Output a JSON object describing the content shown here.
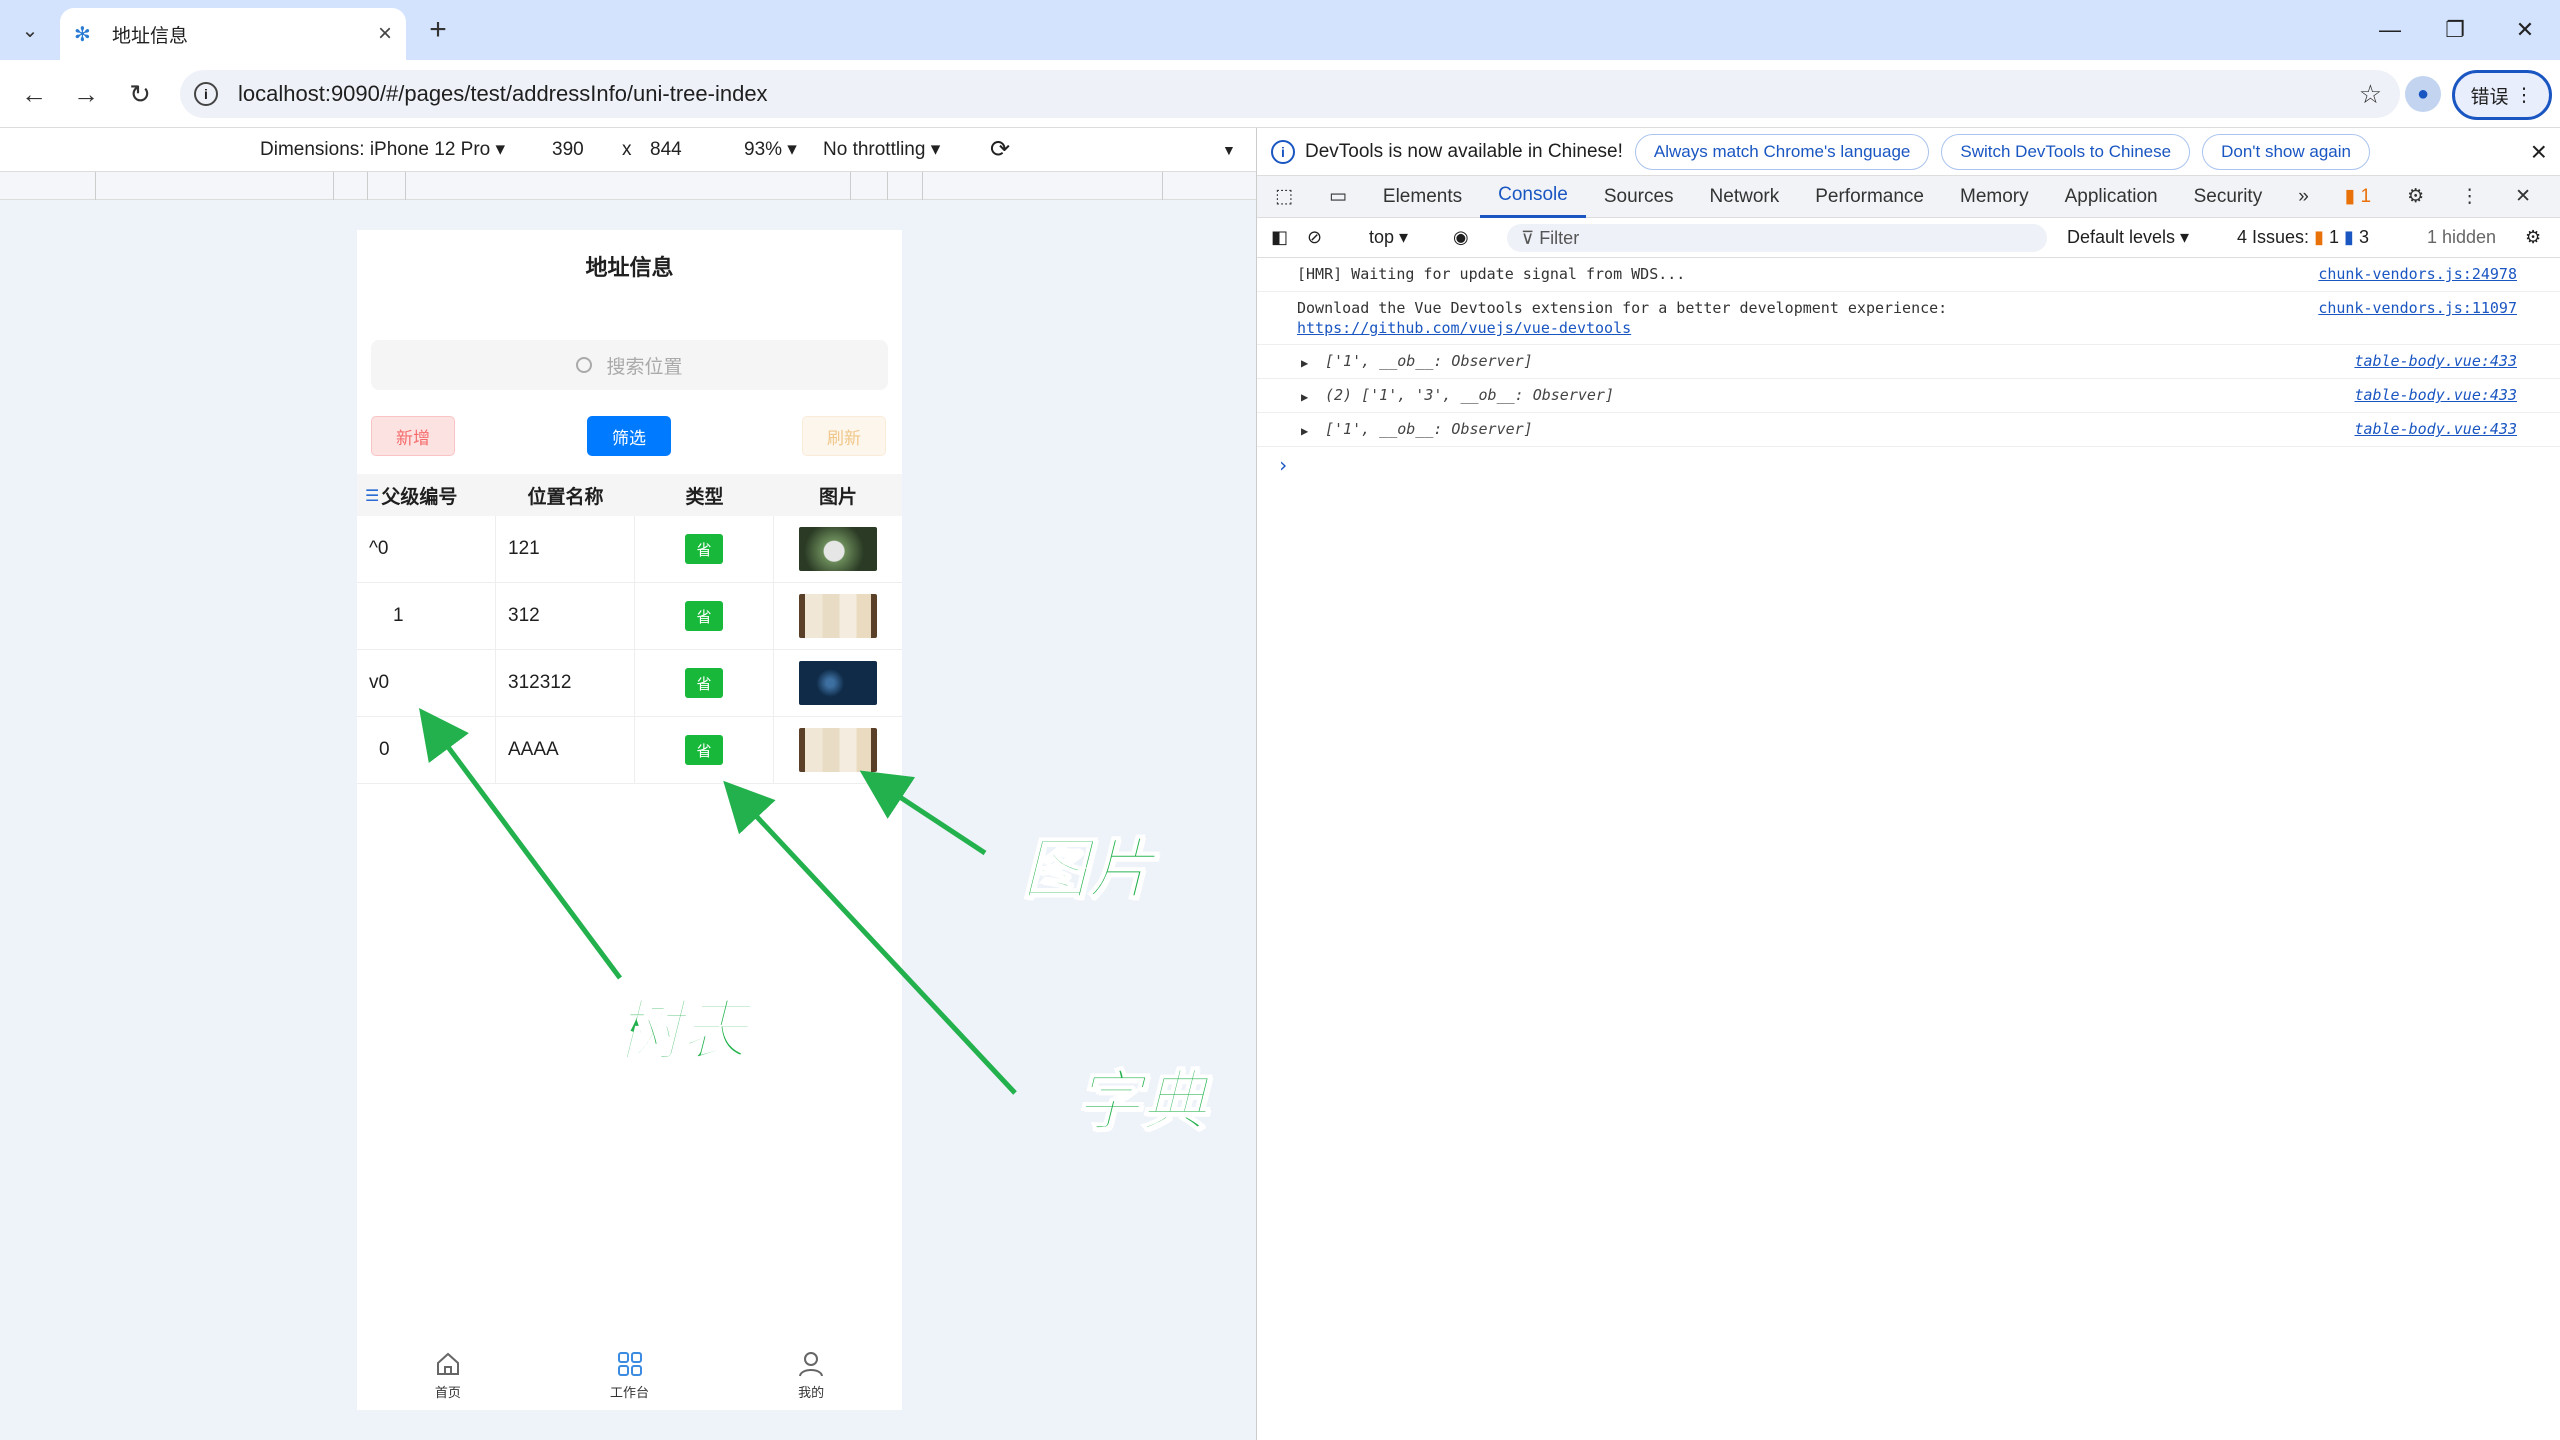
{
  "browser": {
    "tab_title": "地址信息",
    "url": "localhost:9090/#/pages/test/addressInfo/uni-tree-index",
    "error_button": "错误",
    "window_controls": {
      "minimize": "—",
      "restore": "❐",
      "close": "✕"
    }
  },
  "device_toolbar": {
    "dimensions": "Dimensions: iPhone 12 Pro ▾",
    "width": "390",
    "times": "x",
    "height": "844",
    "zoom": "93% ▾",
    "throttling": "No throttling ▾"
  },
  "phone": {
    "title": "地址信息",
    "search_placeholder": "搜索位置",
    "buttons": {
      "add": "新增",
      "filter": "筛选",
      "refresh": "刷新"
    },
    "columns": [
      "父级编号",
      "位置名称",
      "类型",
      "图片"
    ],
    "rows": [
      {
        "toggle": "^",
        "parent": "0",
        "name": "121",
        "type": "省",
        "image": "flower"
      },
      {
        "toggle": "",
        "parent": "1",
        "name": "312",
        "type": "省",
        "image": "dogs"
      },
      {
        "toggle": "v",
        "parent": "0",
        "name": "312312",
        "type": "省",
        "image": "night"
      },
      {
        "toggle": "",
        "parent": "0",
        "name": "AAAA",
        "type": "省",
        "image": "dogs"
      }
    ],
    "nav": [
      {
        "label": "首页",
        "icon": "home-icon"
      },
      {
        "label": "工作台",
        "icon": "grid-icon"
      },
      {
        "label": "我的",
        "icon": "user-icon"
      }
    ]
  },
  "annotations": {
    "tree_table": "树表",
    "dictionary": "字典",
    "image": "图片",
    "accent": "#22b14c"
  },
  "devtools": {
    "info_text": "DevTools is now available in Chinese!",
    "info_buttons": [
      "Always match Chrome's language",
      "Switch DevTools to Chinese",
      "Don't show again"
    ],
    "tabs": [
      "Elements",
      "Console",
      "Sources",
      "Network",
      "Performance",
      "Memory",
      "Application",
      "Security"
    ],
    "active_tab": "Console",
    "issues_badge": "1",
    "context": "top ▾",
    "filter_placeholder": "Filter",
    "levels": "Default levels ▾",
    "issues": "4 Issues:",
    "issues_warn": "1",
    "issues_info": "3",
    "hidden": "1 hidden",
    "logs": [
      {
        "text": "[HMR] Waiting for update signal from WDS...",
        "source": "chunk-vendors.js:24978"
      },
      {
        "text": "Download the Vue Devtools extension for a better development experience:",
        "link": "https://github.com/vuejs/vue-devtools",
        "source": "chunk-vendors.js:11097"
      },
      {
        "text": "['1', __ob__: Observer]",
        "source": "table-body.vue:433"
      },
      {
        "text": "(2) ['1', '3', __ob__: Observer]",
        "source": "table-body.vue:433"
      },
      {
        "text": "['1', __ob__: Observer]",
        "source": "table-body.vue:433"
      }
    ]
  }
}
